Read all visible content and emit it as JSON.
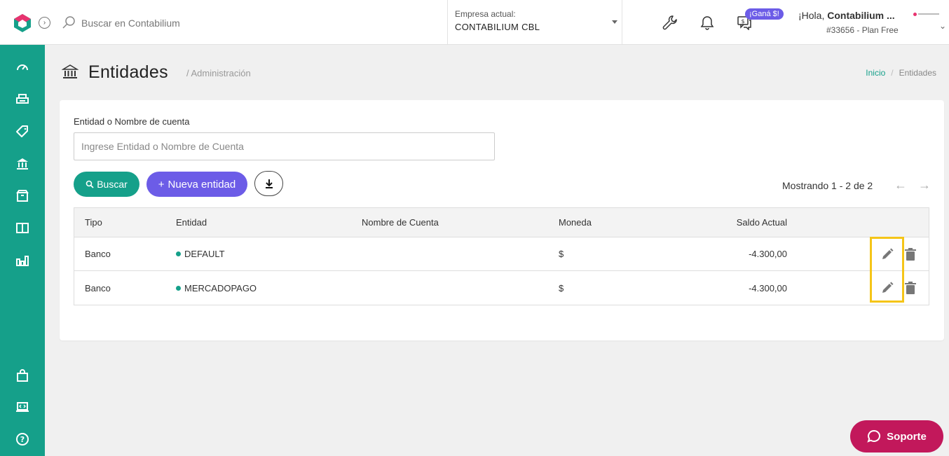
{
  "topbar": {
    "search_placeholder": "Buscar en Contabilium",
    "company_label": "Empresa actual:",
    "company_name": "CONTABILIUM CBL",
    "gana_badge": "¡Ganá $!",
    "greeting": "¡Hola,",
    "user_name": "Contabilium ...",
    "plan": "#33656 - Plan Free"
  },
  "sidebar": {
    "items": [
      {
        "icon": "dashboard-icon"
      },
      {
        "icon": "printer-icon"
      },
      {
        "icon": "tag-icon"
      },
      {
        "icon": "bank-icon"
      },
      {
        "icon": "box-icon"
      },
      {
        "icon": "book-icon"
      },
      {
        "icon": "bar-chart-icon"
      }
    ],
    "bottom_items": [
      {
        "icon": "shopping-bag-icon"
      },
      {
        "icon": "laptop-code-icon"
      },
      {
        "icon": "help-icon"
      }
    ]
  },
  "header": {
    "title": "Entidades",
    "subtitle": "/ Administración",
    "breadcrumb_home": "Inicio",
    "breadcrumb_sep": "/",
    "breadcrumb_current": "Entidades"
  },
  "filter": {
    "label": "Entidad o Nombre de cuenta",
    "placeholder": "Ingrese Entidad o Nombre de Cuenta",
    "value": ""
  },
  "actions": {
    "buscar": "Buscar",
    "nueva": "Nueva entidad",
    "showing": "Mostrando 1 - 2 de 2"
  },
  "table": {
    "headers": {
      "tipo": "Tipo",
      "entidad": "Entidad",
      "nombre": "Nombre de Cuenta",
      "moneda": "Moneda",
      "saldo": "Saldo Actual"
    },
    "rows": [
      {
        "tipo": "Banco",
        "entidad": "DEFAULT",
        "nombre": "",
        "moneda": "$",
        "saldo": "-4.300,00"
      },
      {
        "tipo": "Banco",
        "entidad": "MERCADOPAGO",
        "nombre": "",
        "moneda": "$",
        "saldo": "-4.300,00"
      }
    ]
  },
  "support": {
    "label": "Soporte"
  },
  "colors": {
    "brand": "#15a08a",
    "accent": "#6c5ce7",
    "support": "#c2185b",
    "highlight": "#f5c518"
  }
}
